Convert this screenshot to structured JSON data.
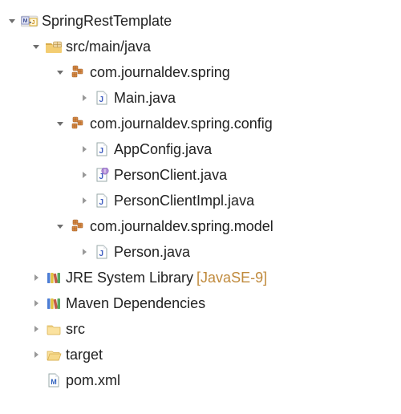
{
  "project": {
    "name": "SpringRestTemplate"
  },
  "src_main_java": {
    "label": "src/main/java"
  },
  "packages": {
    "spring": {
      "label": "com.journaldev.spring",
      "files": {
        "main": "Main.java"
      }
    },
    "spring_config": {
      "label": "com.journaldev.spring.config",
      "files": {
        "appconfig": "AppConfig.java",
        "personclient": "PersonClient.java",
        "personclientimpl": "PersonClientImpl.java"
      }
    },
    "spring_model": {
      "label": "com.journaldev.spring.model",
      "files": {
        "person": "Person.java"
      }
    }
  },
  "libraries": {
    "jre": {
      "label": "JRE System Library",
      "qualifier": "[JavaSE-9]"
    },
    "maven": {
      "label": "Maven Dependencies"
    }
  },
  "folders": {
    "src": "src",
    "target": "target"
  },
  "files": {
    "pom": "pom.xml"
  }
}
